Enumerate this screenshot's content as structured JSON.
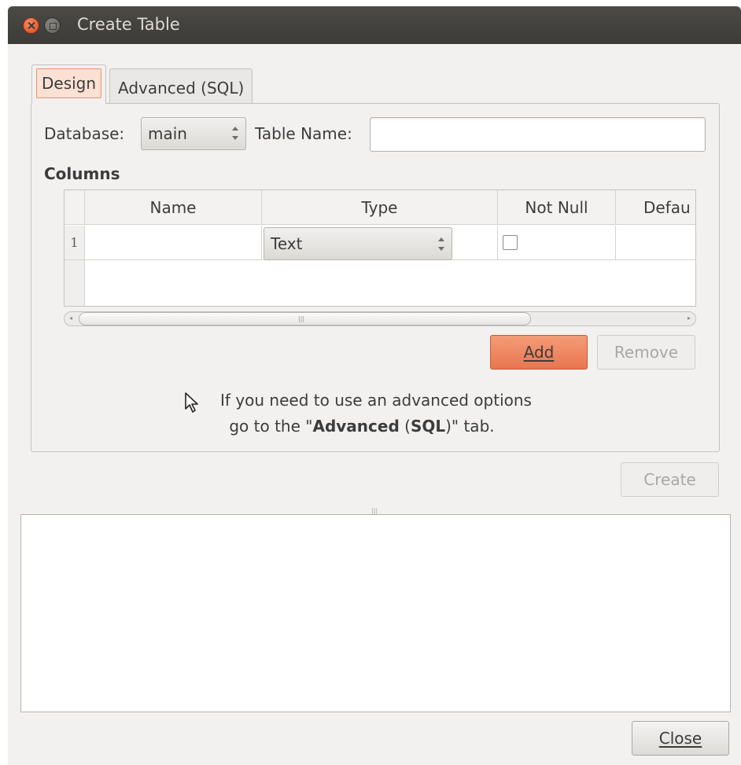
{
  "window": {
    "title": "Create Table"
  },
  "tabs": [
    {
      "label": "Design",
      "active": true
    },
    {
      "label": "Advanced (SQL)",
      "active": false
    }
  ],
  "design": {
    "database_label": "Database:",
    "database_value": "main",
    "table_name_label": "Table Name:",
    "table_name_value": "",
    "columns_label": "Columns",
    "columns_table": {
      "headers": [
        "Name",
        "Type",
        "Not Null",
        "Defau"
      ],
      "rows": [
        {
          "row_number": "1",
          "name": "",
          "type": "Text",
          "not_null": false,
          "default": ""
        }
      ]
    },
    "add_button": "Add",
    "remove_button": "Remove",
    "hint_line1": "If you need to use an advanced options",
    "hint_prefix": "go to the \"",
    "hint_bold1": "Advanced",
    "hint_paren_open": " (",
    "hint_bold2": "SQL",
    "hint_suffix": ")\" tab."
  },
  "create_button": "Create",
  "close_button": "Close",
  "colors": {
    "accent": "#e8764f",
    "titlebar": "#3c3b37",
    "window_bg": "#f2f1f0"
  }
}
